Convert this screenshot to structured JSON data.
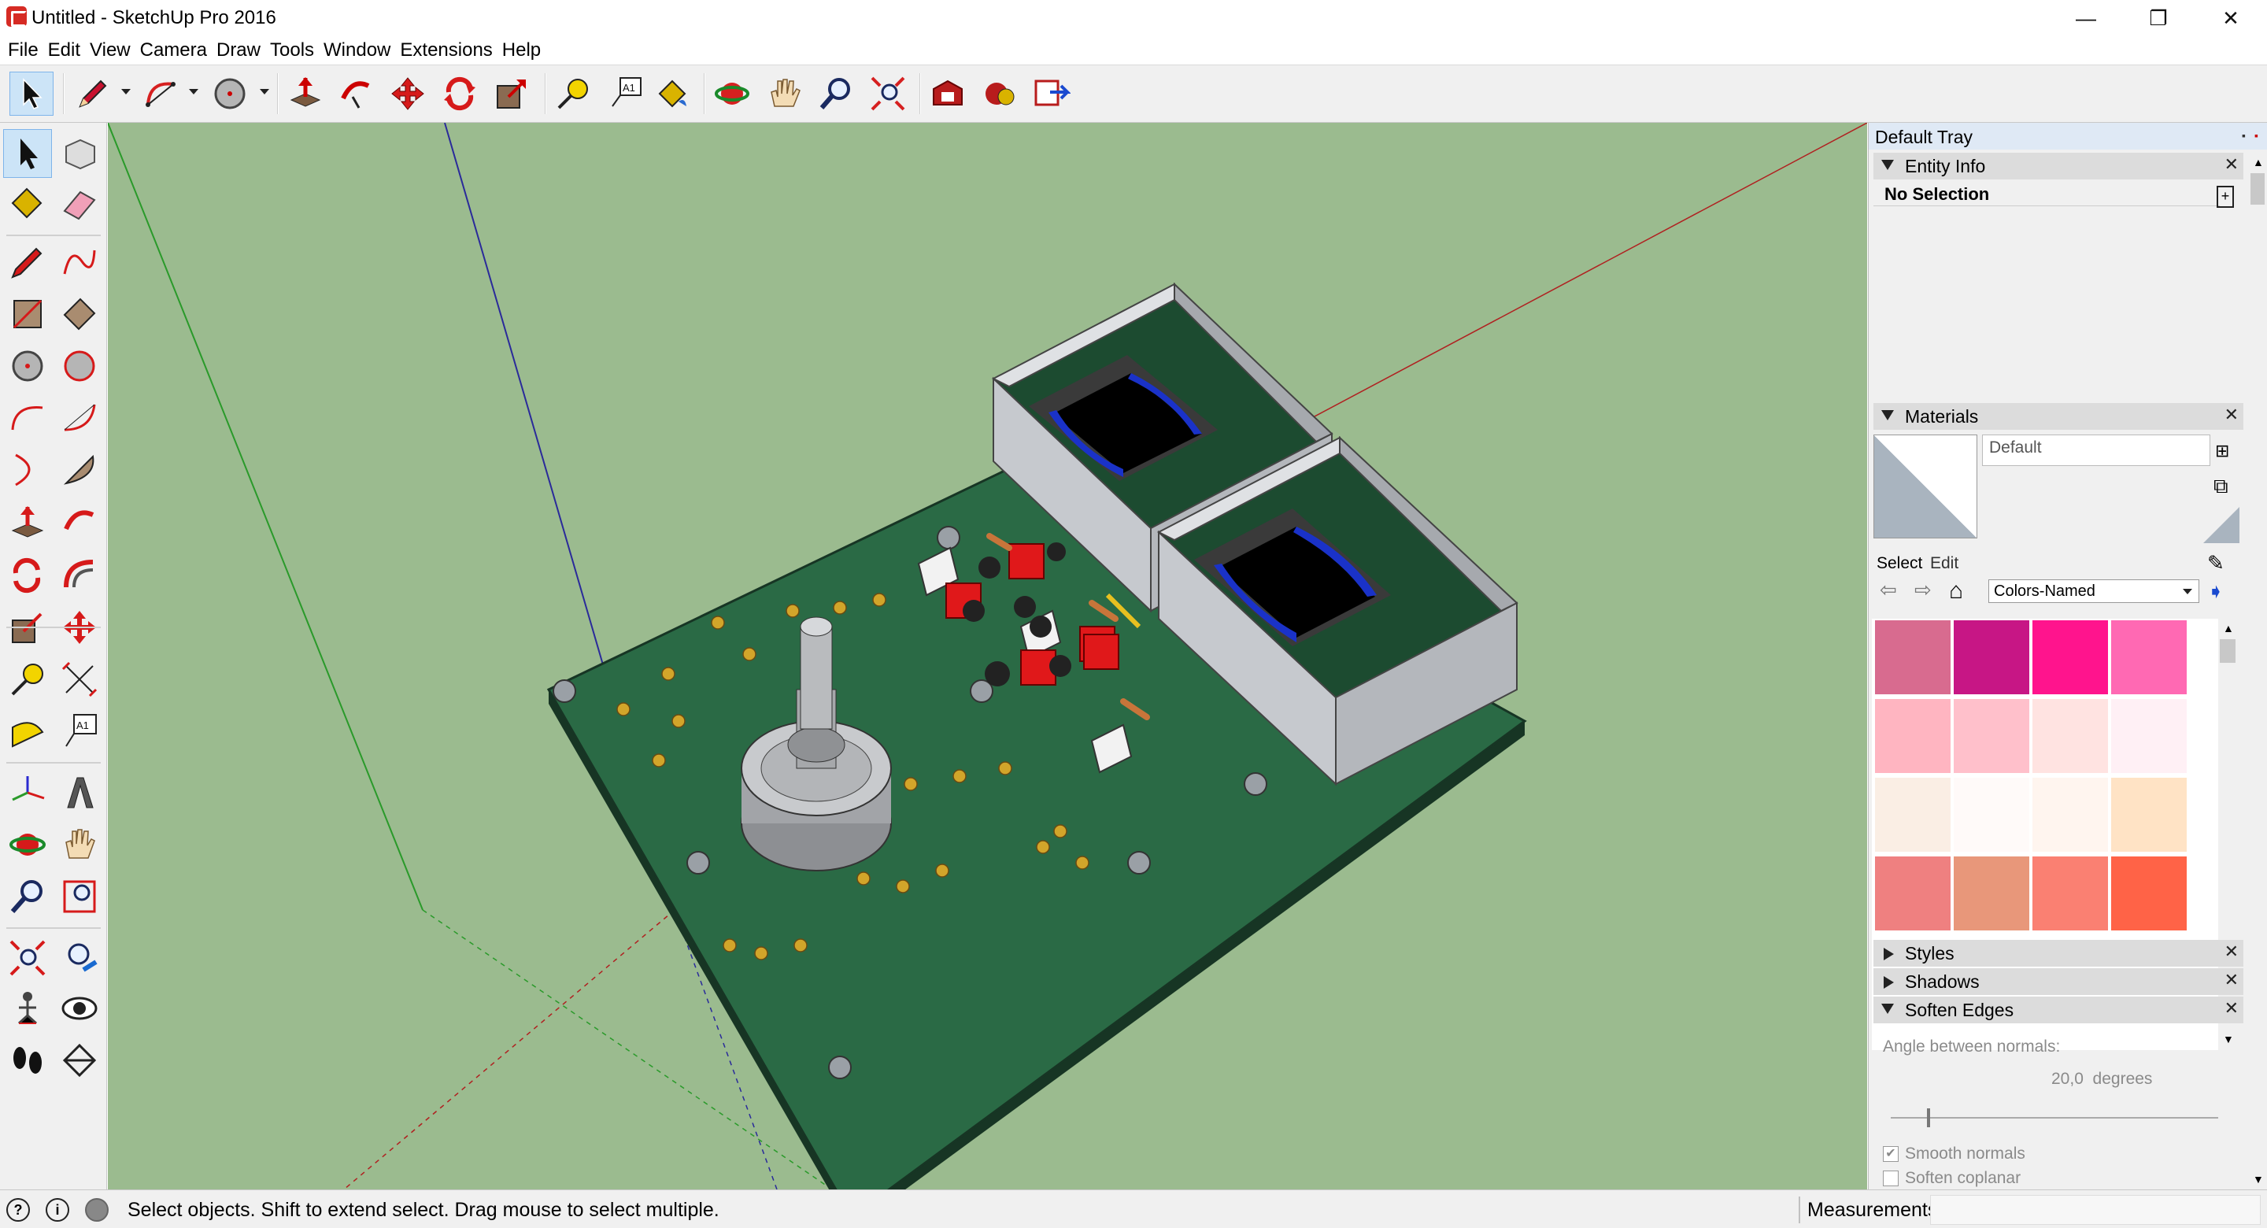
{
  "window": {
    "title": "Untitled - SketchUp Pro 2016",
    "minimize_glyph": "—",
    "restore_glyph": "❐",
    "close_glyph": "✕"
  },
  "menu": [
    "File",
    "Edit",
    "View",
    "Camera",
    "Draw",
    "Tools",
    "Window",
    "Extensions",
    "Help"
  ],
  "toolbar": {
    "tools": [
      "select-arrow-icon",
      "pencil-line-icon",
      "arc-icon",
      "circle-icon",
      "push-pull-icon",
      "follow-me-icon",
      "move-icon",
      "rotate-icon",
      "scale-icon",
      "tape-measure-icon",
      "text-label-icon",
      "paint-bucket-icon",
      "orbit-icon",
      "pan-icon",
      "zoom-icon",
      "zoom-extents-icon",
      "warehouse-icon",
      "extension-warehouse-icon",
      "send-to-layout-icon"
    ],
    "text_tool_label": "A1"
  },
  "left_tools": [
    "select-icon",
    "make-component-icon",
    "paint-bucket-icon",
    "eraser-icon",
    "line-icon",
    "freehand-icon",
    "rectangle-icon",
    "rotated-rectangle-icon",
    "circle-icon",
    "polygon-icon",
    "arc-icon",
    "two-point-arc-icon",
    "three-point-arc-icon",
    "pie-icon",
    "push-pull-icon",
    "follow-me-icon",
    "rotate-icon",
    "offset-icon",
    "scale-icon",
    "move-icon",
    "tape-measure-icon",
    "dimension-icon",
    "protractor-icon",
    "text-icon",
    "axes-icon",
    "three-d-text-icon",
    "orbit-icon",
    "pan-icon",
    "zoom-icon",
    "zoom-window-icon",
    "zoom-extents-icon",
    "previous-view-icon",
    "position-camera-icon",
    "look-around-icon",
    "walk-icon",
    "section-plane-icon"
  ],
  "tray": {
    "title": "Default Tray",
    "entity_info": {
      "label": "Entity Info",
      "selection": "No Selection"
    },
    "materials": {
      "label": "Materials",
      "current": "Default",
      "tab_select": "Select",
      "tab_edit": "Edit",
      "collection": "Colors-Named",
      "swatches": [
        "#d86b8f",
        "#c71685",
        "#ff148d",
        "#ff69b3",
        "#ffb5c1",
        "#ffc0cb",
        "#ffe3e1",
        "#fff0f5",
        "#faeee4",
        "#fffaf9",
        "#fff5ef",
        "#ffe3c5",
        "#ef8080",
        "#e8977a",
        "#fa8072",
        "#ff6347"
      ]
    },
    "styles": {
      "label": "Styles"
    },
    "shadows": {
      "label": "Shadows"
    },
    "soften_edges": {
      "label": "Soften Edges",
      "angle_label": "Angle between normals:",
      "angle_value": "20,0  degrees",
      "angle_fraction": 0.111,
      "smooth_normals": "Smooth normals",
      "smooth_checked": true,
      "soften_coplanar": "Soften coplanar",
      "coplanar_checked": false
    }
  },
  "status": {
    "hint": "Select objects. Shift to extend select. Drag mouse to select multiple.",
    "measurements_label": "Measurements"
  },
  "colors": {
    "viewport_bg": "#9bbb8f",
    "pcb": "#2a6a45",
    "pcb_edge": "#1c3f2a",
    "enclosure": "#c9ccd2",
    "transformer": "#1a32c8",
    "red_part": "#e0181a"
  }
}
